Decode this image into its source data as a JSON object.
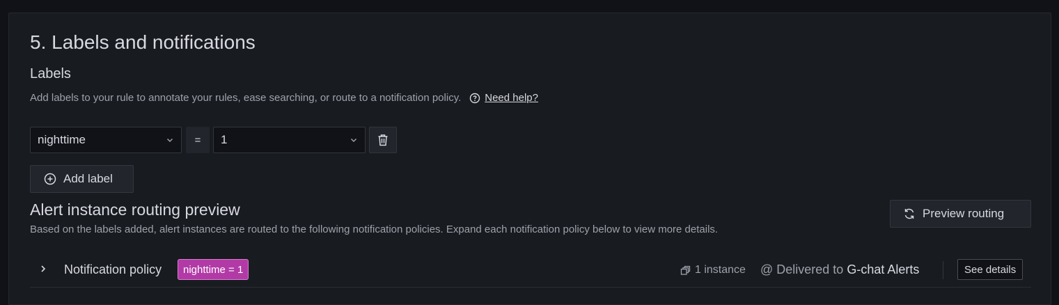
{
  "section": {
    "title": "5. Labels and notifications",
    "labels_heading": "Labels",
    "labels_description": "Add labels to your rule to annotate your rules, ease searching, or route to a notification policy.",
    "help_link": "Need help?"
  },
  "label_row": {
    "key_value": "nighttime",
    "operator": "=",
    "value": "1"
  },
  "add_label_button": "Add label",
  "routing": {
    "title": "Alert instance routing preview",
    "description": "Based on the labels added, alert instances are routed to the following notification policies. Expand each notification policy below to view more details.",
    "preview_button": "Preview routing"
  },
  "policy": {
    "label": "Notification policy",
    "matcher": "nighttime = 1",
    "instances": "1 instance",
    "delivered_prefix": "@ Delivered to",
    "contact_point": "G-chat Alerts",
    "see_details": "See details"
  },
  "icons": [
    "question-circle-icon",
    "chevron-down-icon",
    "trash-icon",
    "plus-circle-icon",
    "sync-icon",
    "chevron-right-icon",
    "instances-icon"
  ],
  "colors": {
    "background": "#111217",
    "panel": "#181b1f",
    "badge": "#b23aa6"
  }
}
